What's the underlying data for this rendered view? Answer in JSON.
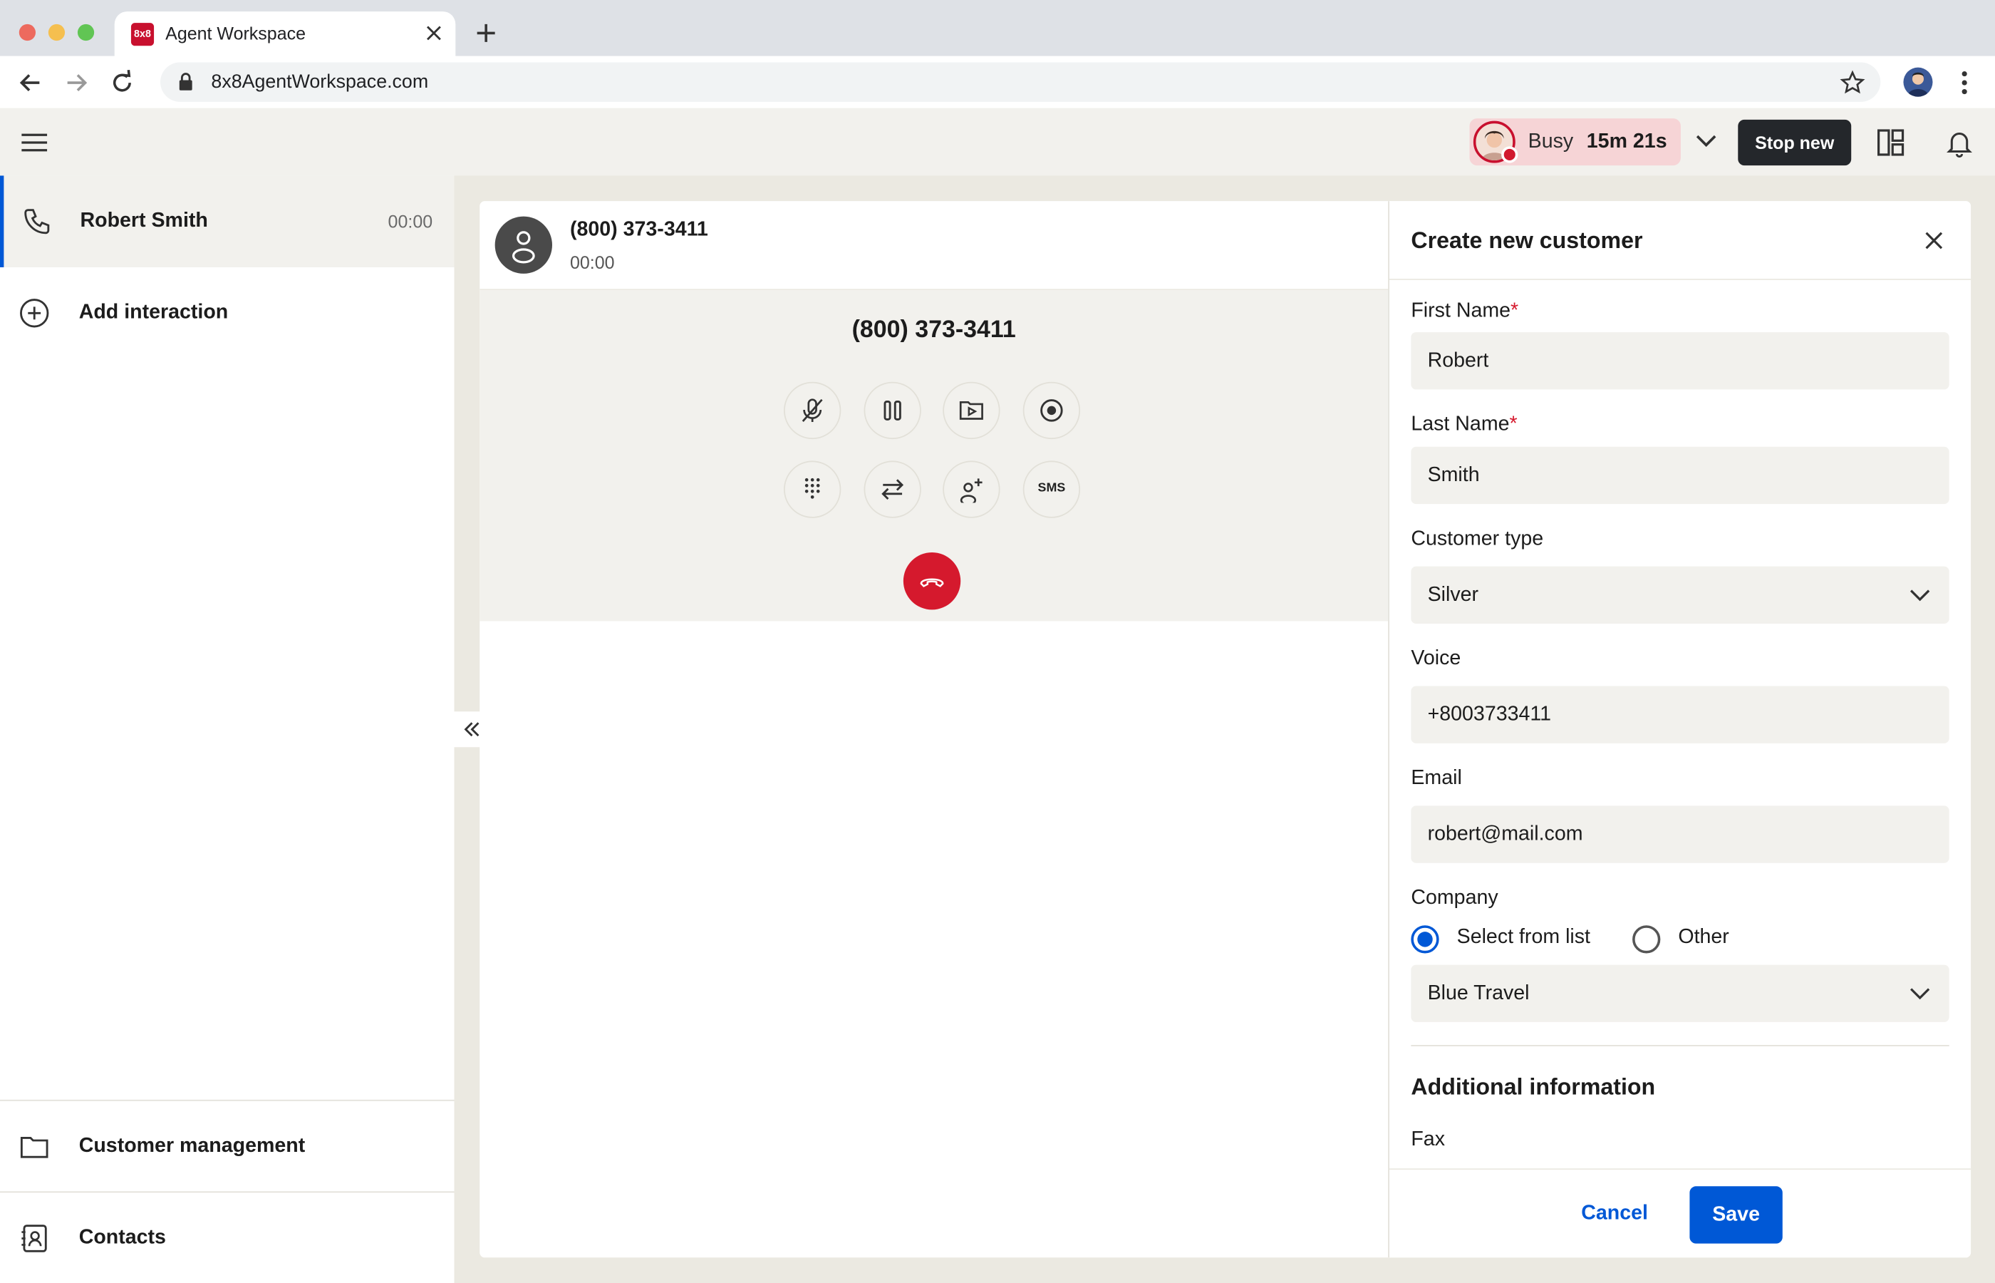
{
  "browser": {
    "tab_title": "Agent Workspace",
    "favicon_text": "8x8",
    "url": "8x8AgentWorkspace.com"
  },
  "header": {
    "status_label": "Busy",
    "status_timer": "15m 21s",
    "stop_new_label": "Stop new"
  },
  "sidebar": {
    "interaction": {
      "name": "Robert Smith",
      "time": "00:00"
    },
    "add_interaction_label": "Add interaction",
    "nav": [
      {
        "label": "Customer management"
      },
      {
        "label": "Contacts"
      }
    ]
  },
  "call": {
    "header_number": "(800) 373-3411",
    "header_time": "00:00",
    "control_number": "(800) 373-3411",
    "sms_label": "SMS"
  },
  "panel": {
    "title": "Create new customer",
    "first_name_label": "First Name",
    "first_name_value": "Robert",
    "last_name_label": "Last Name",
    "last_name_value": "Smith",
    "required_mark": "*",
    "customer_type_label": "Customer type",
    "customer_type_value": "Silver",
    "voice_label": "Voice",
    "voice_value": "+8003733411",
    "email_label": "Email",
    "email_value": "robert@mail.com",
    "company_label": "Company",
    "radio_select_from_list": "Select from list",
    "radio_other": "Other",
    "company_value": "Blue Travel",
    "additional_info_title": "Additional information",
    "fax_label": "Fax",
    "cancel_label": "Cancel",
    "save_label": "Save"
  },
  "colors": {
    "accent": "#0058d6",
    "danger": "#d5192d",
    "busy_bg": "#f6d4d6",
    "app_bg": "#ebe9e1"
  }
}
